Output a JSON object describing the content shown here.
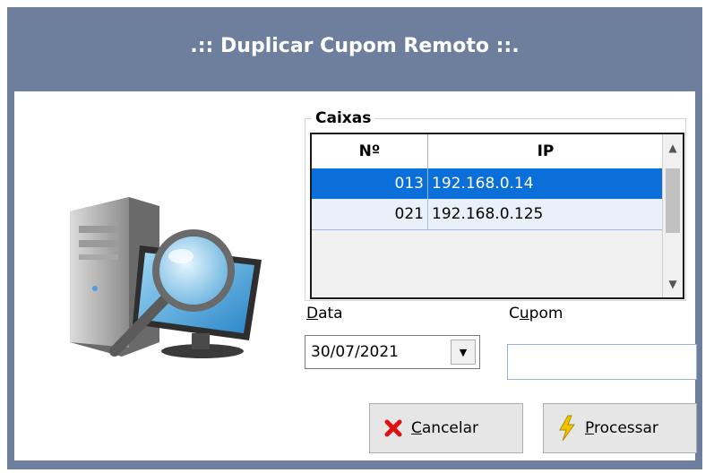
{
  "window": {
    "title": ".:: Duplicar Cupom Remoto ::."
  },
  "caixas": {
    "label": "Caixas",
    "columns": {
      "num": "Nº",
      "ip": "IP"
    },
    "rows": [
      {
        "num": "013",
        "ip": "192.168.0.14",
        "selected": true
      },
      {
        "num": "021",
        "ip": "192.168.0.125",
        "selected": false
      }
    ]
  },
  "data_field": {
    "label_underlined": "D",
    "label_rest": "ata",
    "value": "30/07/2021"
  },
  "cupom_field": {
    "label_pre": "C",
    "label_underlined": "u",
    "label_rest": "pom",
    "value": ""
  },
  "buttons": {
    "cancel": {
      "underlined": "C",
      "rest": "ancelar"
    },
    "process": {
      "underlined": "P",
      "rest": "rocessar"
    }
  },
  "colors": {
    "titlebar": "#6e7f9e",
    "selection": "#0a6fd8",
    "cancel_icon": "#e01010",
    "process_icon": "#f2c400"
  },
  "icons": {
    "dialog": "computer-search-icon",
    "cancel": "x-icon",
    "process": "lightning-icon"
  }
}
